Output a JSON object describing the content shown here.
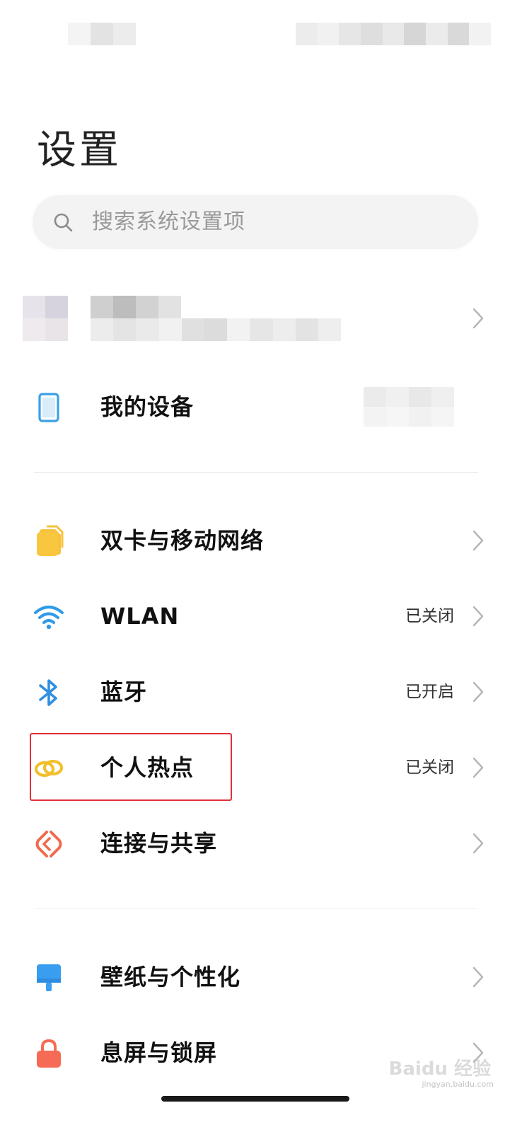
{
  "page": {
    "title": "设置"
  },
  "search": {
    "placeholder": "搜索系统设置项"
  },
  "items": [
    {
      "label": "我的设备",
      "status": "",
      "icon": "phone-icon",
      "color": "#3aa0e6"
    },
    {
      "label": "双卡与移动网络",
      "status": "",
      "icon": "sim-card-icon",
      "color": "#f7c23c"
    },
    {
      "label": "WLAN",
      "status": "已关闭",
      "icon": "wifi-icon",
      "color": "#2f9be8"
    },
    {
      "label": "蓝牙",
      "status": "已开启",
      "icon": "bluetooth-icon",
      "color": "#2f8fe0"
    },
    {
      "label": "个人热点",
      "status": "已关闭",
      "icon": "hotspot-icon",
      "color": "#f2c02e"
    },
    {
      "label": "连接与共享",
      "status": "",
      "icon": "share-icon",
      "color": "#f06a4e"
    },
    {
      "label": "壁纸与个性化",
      "status": "",
      "icon": "wallpaper-icon",
      "color": "#3a9ef0"
    },
    {
      "label": "息屏与锁屏",
      "status": "",
      "icon": "lock-icon",
      "color": "#f56b55"
    }
  ],
  "colors": {
    "highlight": "#e0303a",
    "background": "#ffffff"
  },
  "watermark": {
    "brand": "Baidu 经验",
    "url": "jingyan.baidu.com"
  }
}
